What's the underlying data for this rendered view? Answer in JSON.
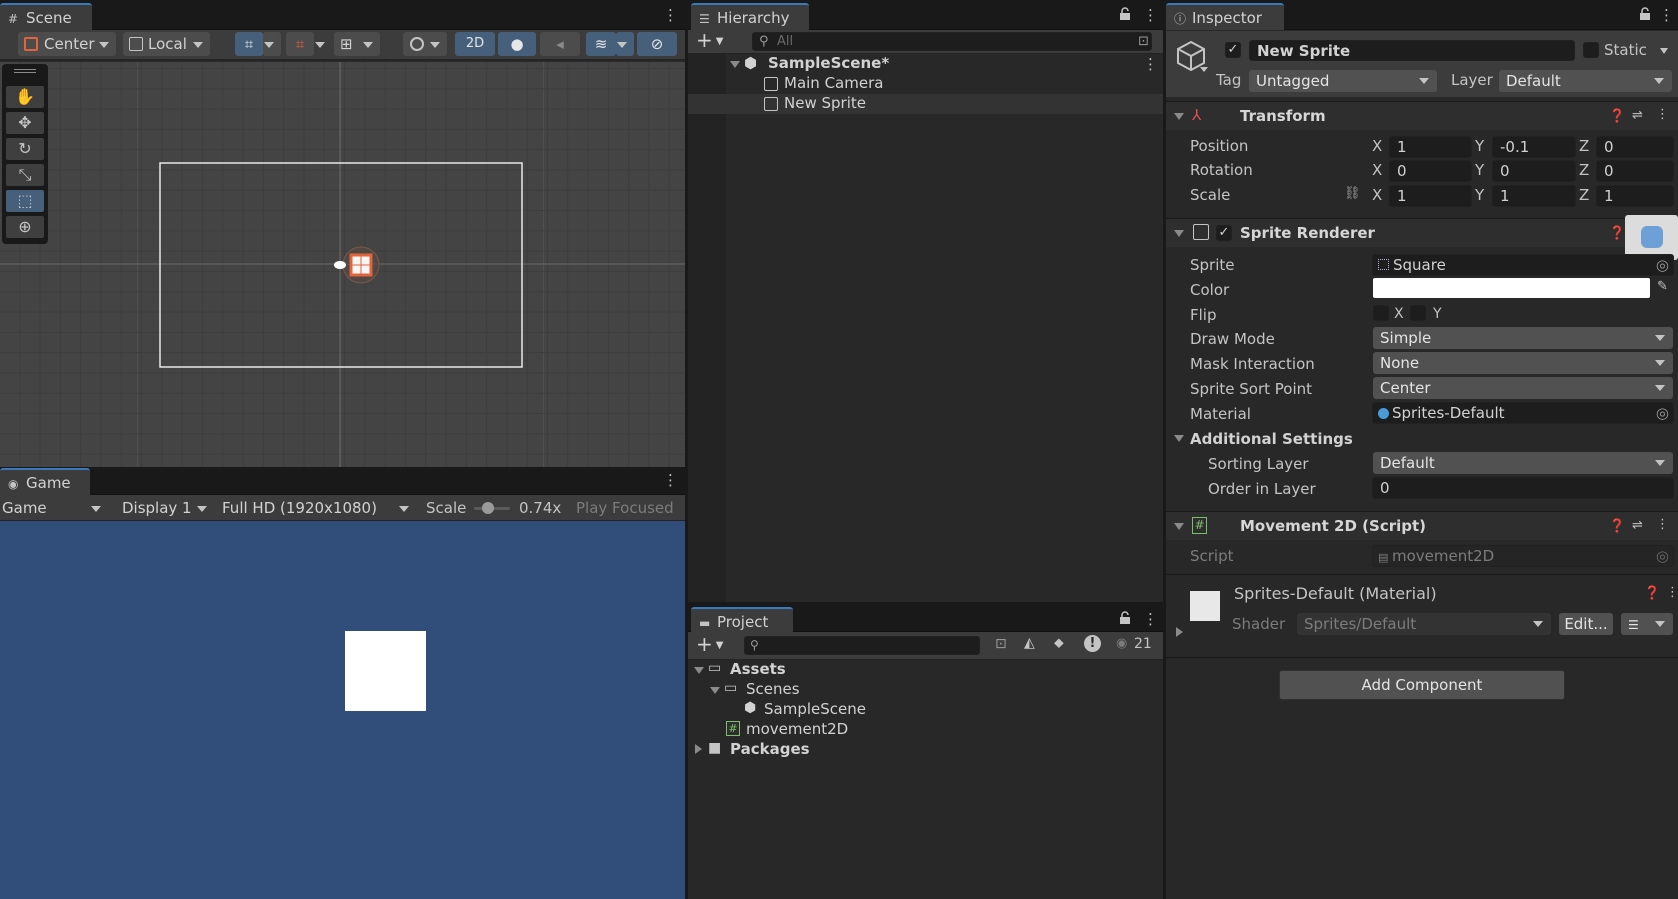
{
  "scene": {
    "tab": "Scene",
    "pivot": "Center",
    "space": "Local",
    "mode2d": "2D"
  },
  "game": {
    "tab": "Game",
    "view": "Game",
    "display": "Display 1",
    "resolution": "Full HD (1920x1080)",
    "scale_label": "Scale",
    "scale_value": "0.74x",
    "play_mode": "Play Focused"
  },
  "hierarchy": {
    "tab": "Hierarchy",
    "search_placeholder": "All",
    "scene": "SampleScene*",
    "items": [
      "Main Camera",
      "New Sprite"
    ]
  },
  "project": {
    "tab": "Project",
    "count": "21",
    "tree": {
      "assets": "Assets",
      "scenes": "Scenes",
      "sample_scene": "SampleScene",
      "script": "movement2D",
      "packages": "Packages"
    }
  },
  "inspector": {
    "tab": "Inspector",
    "name": "New Sprite",
    "static": "Static",
    "tag_label": "Tag",
    "tag": "Untagged",
    "layer_label": "Layer",
    "layer": "Default",
    "transform": {
      "title": "Transform",
      "position_label": "Position",
      "rotation_label": "Rotation",
      "scale_label": "Scale",
      "position": {
        "x": "1",
        "y": "-0.1",
        "z": "0"
      },
      "rotation": {
        "x": "0",
        "y": "0",
        "z": "0"
      },
      "scale": {
        "x": "1",
        "y": "1",
        "z": "1"
      },
      "axis_x": "X",
      "axis_y": "Y",
      "axis_z": "Z"
    },
    "sprite_renderer": {
      "title": "Sprite Renderer",
      "sprite_label": "Sprite",
      "sprite": "Square",
      "color_label": "Color",
      "color": "#ffffff",
      "flip_label": "Flip",
      "flip_x": "X",
      "flip_y": "Y",
      "draw_mode_label": "Draw Mode",
      "draw_mode": "Simple",
      "mask_label": "Mask Interaction",
      "mask": "None",
      "sort_point_label": "Sprite Sort Point",
      "sort_point": "Center",
      "material_label": "Material",
      "material": "Sprites-Default",
      "additional": "Additional Settings",
      "sorting_layer_label": "Sorting Layer",
      "sorting_layer": "Default",
      "order_label": "Order in Layer",
      "order": "0"
    },
    "movement": {
      "title": "Movement 2D (Script)",
      "script_label": "Script",
      "script": "movement2D"
    },
    "material": {
      "title": "Sprites-Default (Material)",
      "shader_label": "Shader",
      "shader": "Sprites/Default",
      "edit": "Edit..."
    },
    "add_component": "Add Component"
  },
  "colors": {
    "game_bg": "#314d79",
    "accent": "#3a79bb",
    "selected_tool": "#46607c"
  }
}
